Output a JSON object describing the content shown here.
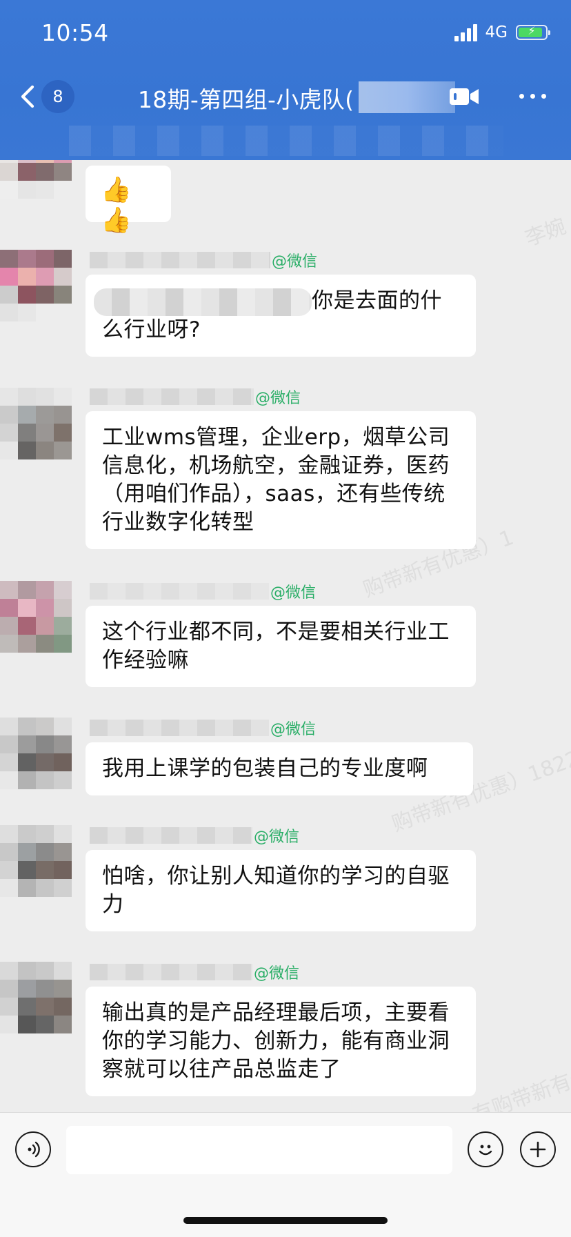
{
  "status_bar": {
    "time": "10:54",
    "network": "4G",
    "battery_charging": true,
    "battery_level_percent": 90
  },
  "nav": {
    "unread_count": "8",
    "title": "18期-第四组-小虎队(",
    "icons": [
      "back-icon",
      "video-call-icon",
      "more-icon"
    ]
  },
  "colors": {
    "header": "#3875d3",
    "bubble": "#ffffff",
    "chat_background": "#ededed",
    "wechat_tag": "#2aae67"
  },
  "messages": [
    {
      "sender_tag": "",
      "text": "👍👍"
    },
    {
      "sender_tag": "@微信",
      "text": "你是去面的什么行业呀?"
    },
    {
      "sender_tag": "@微信",
      "text": "工业wms管理，企业erp，烟草公司信息化，机场航空，金融证券，医药（用咱们作品），saas，还有些传统行业数字化转型"
    },
    {
      "sender_tag": "@微信",
      "text": "这个行业都不同，不是要相关行业工作经验嘛"
    },
    {
      "sender_tag": "@微信",
      "text": "我用上课学的包装自己的专业度啊"
    },
    {
      "sender_tag": "@微信",
      "text": "怕啥，你让别人知道你的学习的自驱力"
    },
    {
      "sender_tag": "@微信",
      "text": "输出真的是产品经理最后项，主要看你的学习能力、创新力，能有商业洞察就可以往产品总监走了"
    }
  ],
  "input_bar": {
    "placeholder": "",
    "icons": [
      "voice-icon",
      "emoji-icon",
      "plus-icon"
    ]
  },
  "watermarks": [
    "李婉",
    "购带新有优惠）1",
    "购带新有优惠）1822",
    "有购带新有优"
  ]
}
